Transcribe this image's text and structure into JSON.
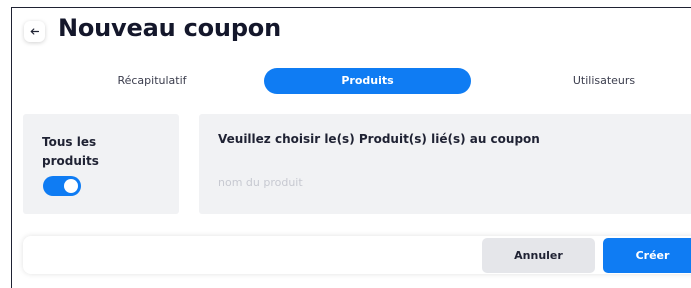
{
  "header": {
    "back_icon": "arrow-left-icon",
    "title": "Nouveau coupon"
  },
  "tabs": [
    {
      "label": "Récapitulatif",
      "active": false
    },
    {
      "label": "Produits",
      "active": true
    },
    {
      "label": "Utilisateurs",
      "active": false
    }
  ],
  "all_products": {
    "label": "Tous les produits",
    "toggle_on": true
  },
  "product_selection": {
    "label": "Veuillez choisir le(s) Produit(s) lié(s) au coupon",
    "input_value": "",
    "input_placeholder": "nom du produit"
  },
  "actions": {
    "cancel_label": "Annuler",
    "create_label": "Créer"
  },
  "colors": {
    "accent": "#0f7cf3",
    "card_bg": "#f1f2f4",
    "cancel_bg": "#e5e6ea",
    "text": "#1f2233"
  }
}
